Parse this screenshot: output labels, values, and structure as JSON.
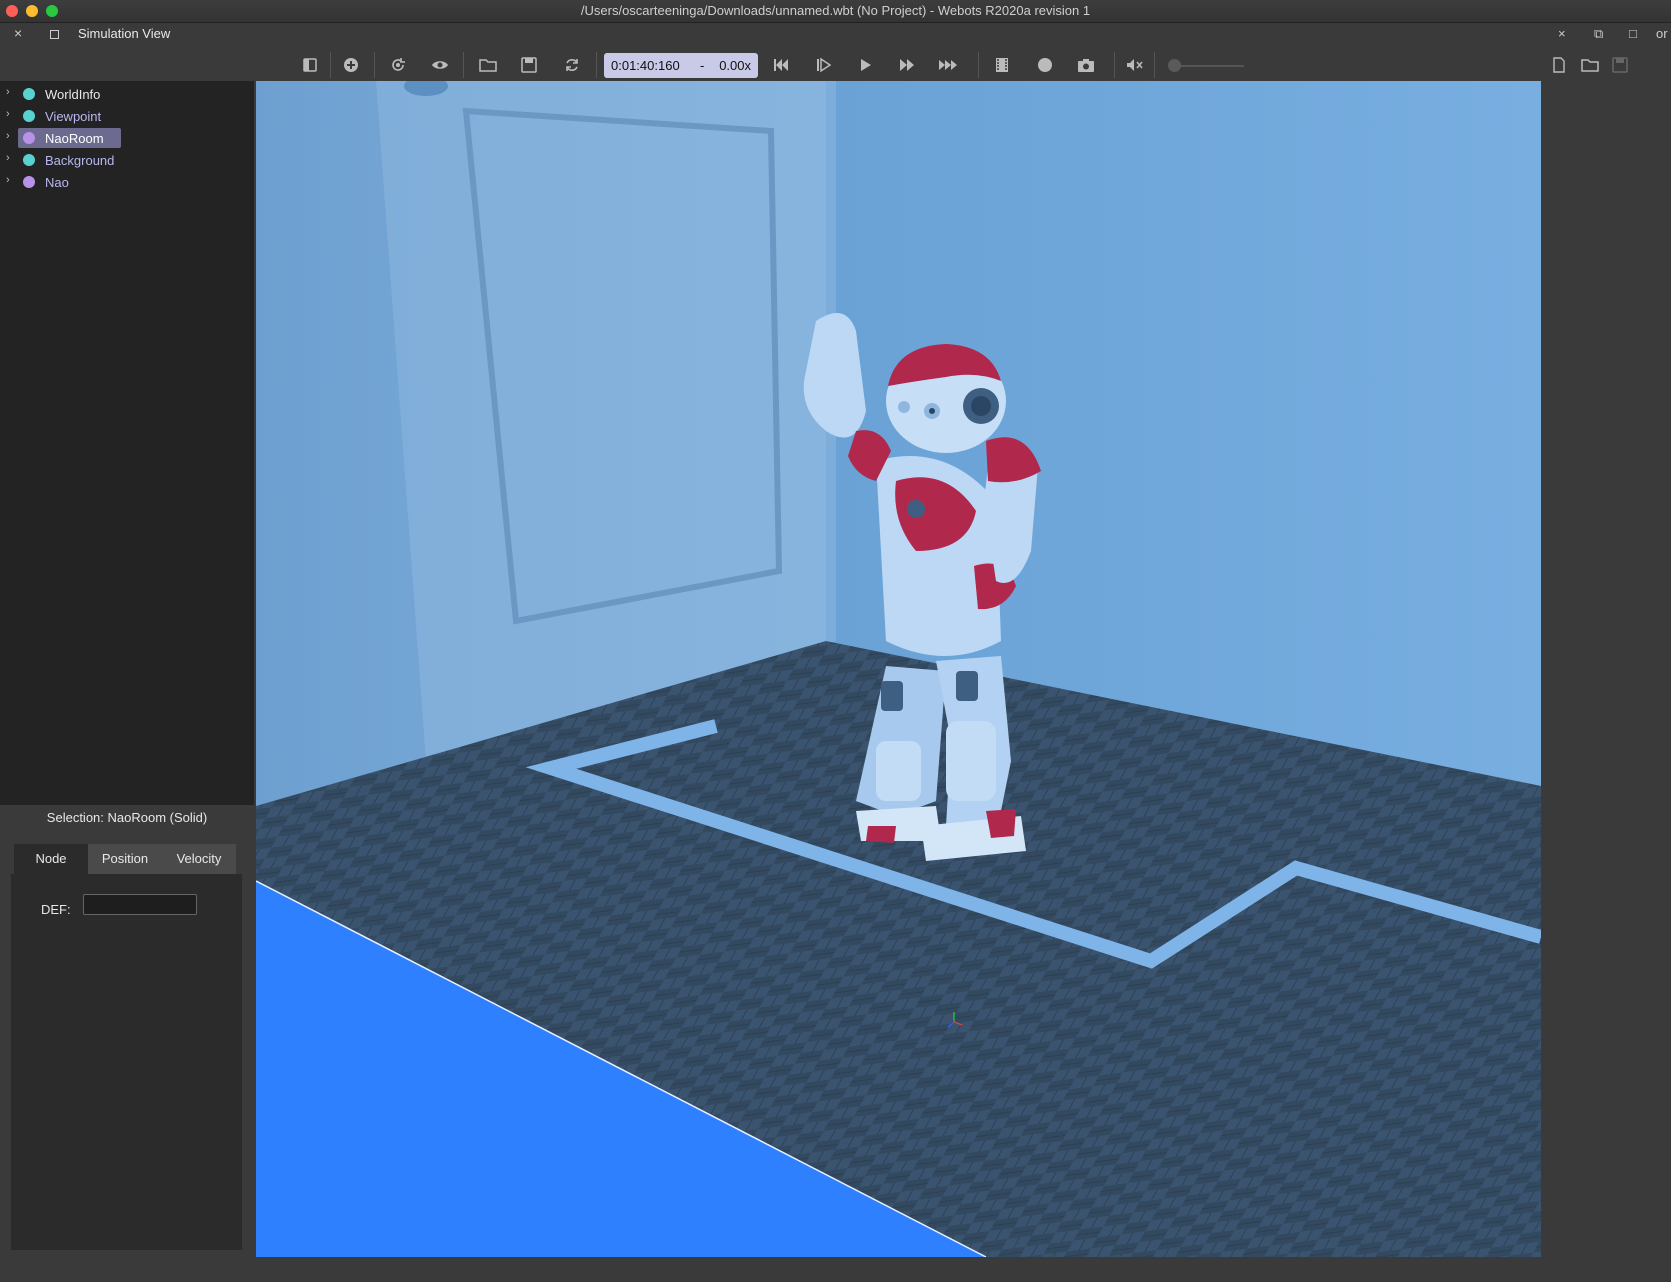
{
  "window": {
    "title": "/Users/oscarteeninga/Downloads/unnamed.wbt (No Project) - Webots R2020a revision 1",
    "traffic_colors": [
      "#ff5f57",
      "#febc2e",
      "#28c840"
    ]
  },
  "dock": {
    "title": "Simulation View",
    "close_glyph": "×",
    "right_glyphs": [
      "×",
      "⧉",
      "□",
      "or"
    ]
  },
  "toolbar": {
    "icons": [
      "sidebar-toggle-icon",
      "add-node-icon",
      "reset-view-icon",
      "eye-icon",
      "open-world-icon",
      "save-world-icon",
      "reload-world-icon",
      "reset-simulation-icon",
      "step-icon",
      "play-icon",
      "fast-forward-icon",
      "fastest-icon",
      "movie-icon",
      "record-icon",
      "screenshot-icon",
      "mute-icon"
    ],
    "time": "0:01:40:160",
    "dash": "-",
    "speed": "0.00x",
    "volume": 0,
    "editor_icons": [
      "new-file-icon",
      "open-file-icon",
      "save-file-icon"
    ]
  },
  "scene_tree": {
    "items": [
      {
        "label": "WorldInfo",
        "color": "#5ad1d1"
      },
      {
        "label": "Viewpoint",
        "color": "#5ad1d1"
      },
      {
        "label": "NaoRoom",
        "color": "#b792e8",
        "selected": true
      },
      {
        "label": "Background",
        "color": "#5ad1d1"
      },
      {
        "label": "Nao",
        "color": "#b792e8"
      }
    ]
  },
  "selection": {
    "title": "Selection: NaoRoom (Solid)",
    "tabs": [
      "Node",
      "Position",
      "Velocity"
    ],
    "active_tab": "Node",
    "def_label": "DEF:",
    "def_value": ""
  },
  "colors": {
    "wall": "#74a8da",
    "floor": "#3a5470",
    "line": "#7fb4e8",
    "ground_plane": "#2f80ff",
    "robot_accent": "#b0284c"
  }
}
